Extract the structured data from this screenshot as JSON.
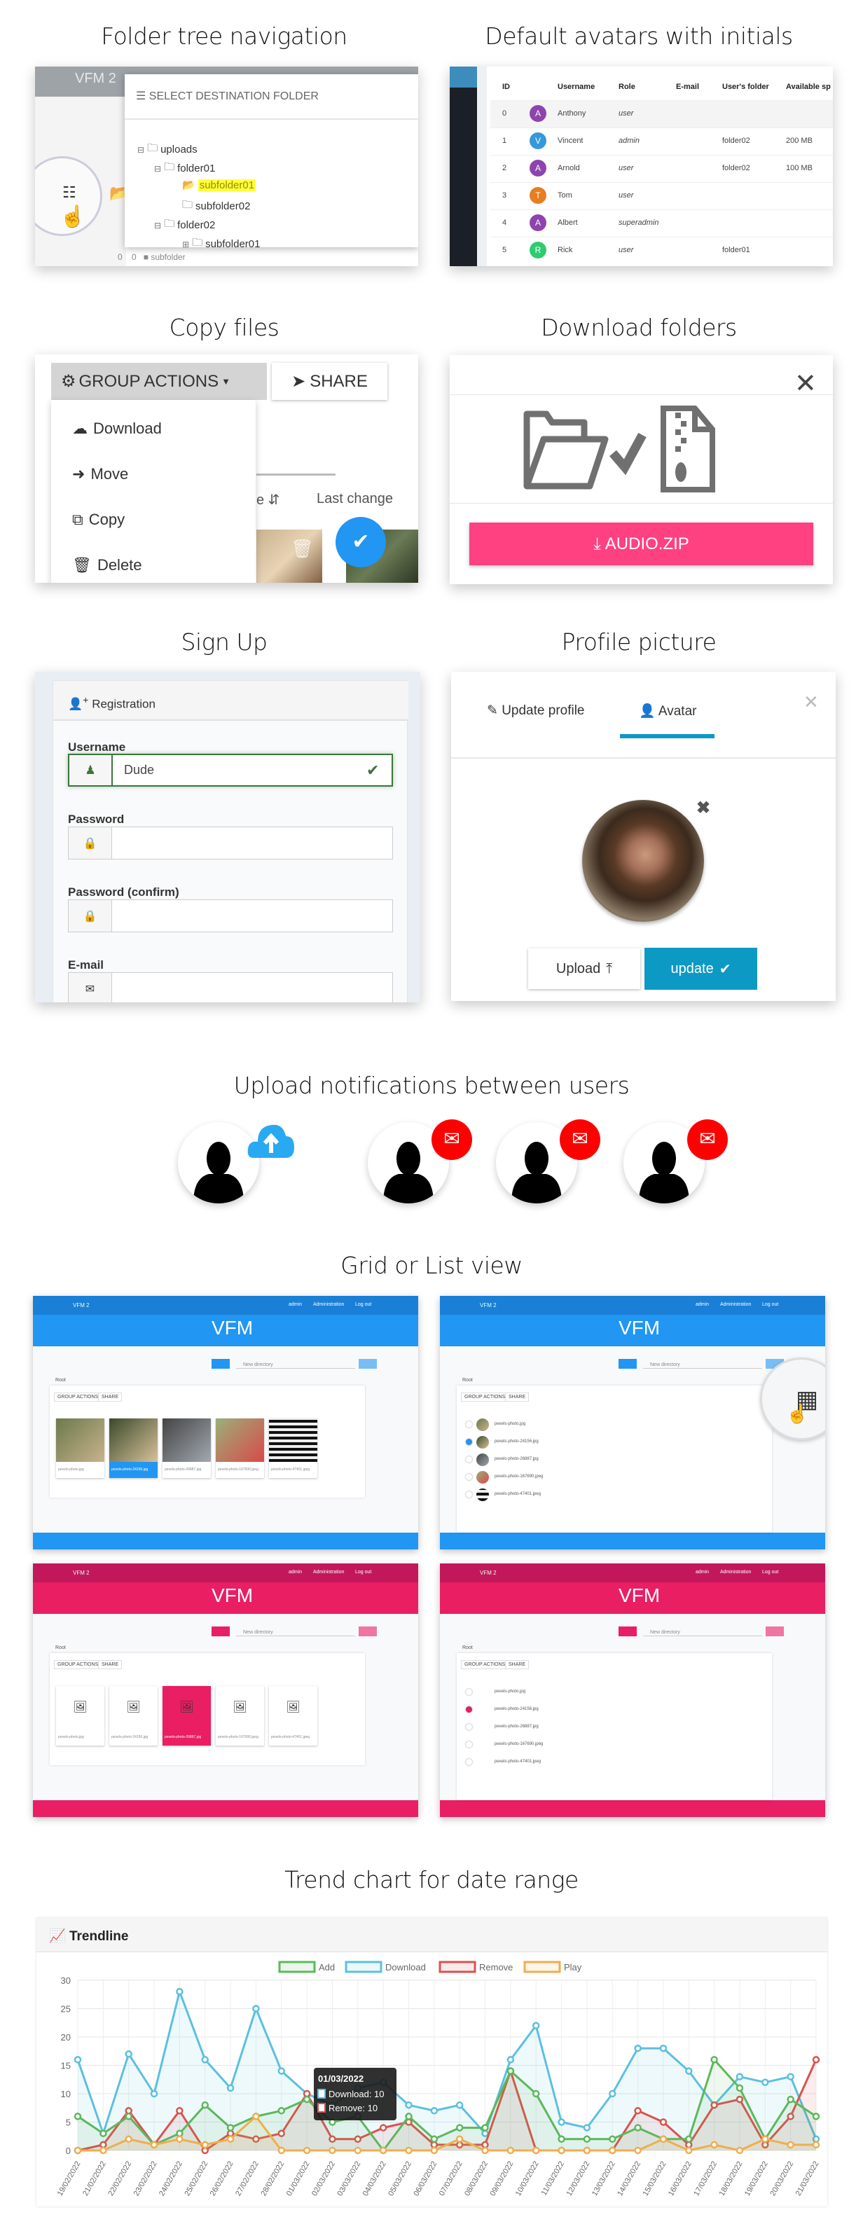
{
  "sections": {
    "folder_tree": "Folder tree navigation",
    "avatars": "Default avatars with initials",
    "copy": "Copy files",
    "download": "Download folders",
    "signup": "Sign Up",
    "profile": "Profile picture",
    "notifications": "Upload notifications between users",
    "gridlist": "Grid or List view",
    "trend": "Trend chart for date range"
  },
  "folder_tree": {
    "app_name": "VFM 2",
    "modal_title": "SELECT DESTINATION FOLDER",
    "tree": [
      {
        "label": "uploads",
        "level": 0,
        "toggle": "minus"
      },
      {
        "label": "folder01",
        "level": 1,
        "toggle": "minus"
      },
      {
        "label": "subfolder01",
        "level": 2,
        "selected": true
      },
      {
        "label": "subfolder02",
        "level": 2
      },
      {
        "label": "folder02",
        "level": 1,
        "toggle": "minus"
      },
      {
        "label": "subfolder01",
        "level": 2,
        "toggle": "plus"
      }
    ],
    "footer_counts": [
      "0",
      "0"
    ],
    "footer_folder": "subfolder"
  },
  "users_table": {
    "columns": [
      "ID",
      "Username",
      "Role",
      "E-mail",
      "User's folder",
      "Available sp"
    ],
    "rows": [
      {
        "id": "0",
        "initial": "A",
        "color": "#8e44ad",
        "username": "Anthony",
        "role": "user",
        "folder": "",
        "space": ""
      },
      {
        "id": "1",
        "initial": "V",
        "color": "#3498db",
        "username": "Vincent",
        "role": "admin",
        "folder": "folder02",
        "space": "200 MB"
      },
      {
        "id": "2",
        "initial": "A",
        "color": "#8e44ad",
        "username": "Arnold",
        "role": "user",
        "folder": "folder02",
        "space": "100 MB"
      },
      {
        "id": "3",
        "initial": "T",
        "color": "#e67e22",
        "username": "Tom",
        "role": "user",
        "folder": "",
        "space": ""
      },
      {
        "id": "4",
        "initial": "A",
        "color": "#8e44ad",
        "username": "Albert",
        "role": "superadmin",
        "folder": "",
        "space": ""
      },
      {
        "id": "5",
        "initial": "R",
        "color": "#2ecc71",
        "username": "Rick",
        "role": "user",
        "folder": "folder01",
        "space": ""
      }
    ]
  },
  "copy_files": {
    "group_actions": "GROUP ACTIONS",
    "share": "SHARE",
    "menu": [
      "Download",
      "Move",
      "Copy",
      "Delete"
    ],
    "col_size_fragment": "e",
    "col_last_change": "Last change"
  },
  "download": {
    "button": "AUDIO.ZIP",
    "button_color": "#ff4081"
  },
  "signup": {
    "title": "Registration",
    "username_label": "Username",
    "username_value": "Dude",
    "password_label": "Password",
    "confirm_label": "Password (confirm)",
    "email_label": "E-mail"
  },
  "profile": {
    "tab_update": "Update profile",
    "tab_avatar": "Avatar",
    "upload": "Upload",
    "update": "update",
    "accent": "#0c9ac4"
  },
  "mini_app": {
    "app_name": "VFM 2",
    "user": "admin",
    "admin_link": "Administration",
    "logout": "Log out",
    "logo": "VFM",
    "new_directory": "New directory",
    "root": "Root",
    "group_actions": "GROUP ACTIONS",
    "share": "SHARE",
    "files": [
      "pexels-photo.jpg",
      "pexels-photo-24156.jpg",
      "pexels-photo-26887.jpg",
      "pexels-photo-167690.jpeg",
      "pexels-photo-47401.jpeg"
    ],
    "themes": [
      {
        "color": "#2196f3",
        "dark": "#1a7fd6",
        "view": "grid"
      },
      {
        "color": "#2196f3",
        "dark": "#1a7fd6",
        "view": "list"
      },
      {
        "color": "#e91e63",
        "dark": "#c2185b",
        "view": "grid"
      },
      {
        "color": "#e91e63",
        "dark": "#c2185b",
        "view": "list"
      }
    ]
  },
  "chart_data": {
    "type": "line",
    "title": "Trendline",
    "ylim": [
      0,
      30
    ],
    "yticks": [
      0,
      5,
      10,
      15,
      20,
      25,
      30
    ],
    "grid": true,
    "legend": "top",
    "categories": [
      "19/02/2022",
      "21/02/2022",
      "22/02/2022",
      "23/02/2022",
      "24/02/2022",
      "25/02/2022",
      "26/02/2022",
      "27/02/2022",
      "28/02/2022",
      "01/03/2022",
      "02/03/2022",
      "03/03/2022",
      "04/03/2022",
      "05/03/2022",
      "06/03/2022",
      "07/03/2022",
      "08/03/2022",
      "09/03/2022",
      "10/03/2022",
      "11/03/2022",
      "12/03/2022",
      "13/03/2022",
      "14/03/2022",
      "15/03/2022",
      "16/03/2022",
      "17/03/2022",
      "18/03/2022",
      "19/03/2022",
      "20/03/2022",
      "21/03/2022"
    ],
    "series": [
      {
        "name": "Add",
        "color": "#5cb85c",
        "values": [
          6,
          3,
          6,
          1,
          3,
          8,
          4,
          6,
          7,
          9,
          5,
          6,
          0,
          6,
          2,
          4,
          4,
          14,
          10,
          2,
          2,
          2,
          4,
          2,
          2,
          16,
          11,
          2,
          9,
          6
        ]
      },
      {
        "name": "Download",
        "color": "#5bc0de",
        "values": [
          16,
          3,
          17,
          10,
          28,
          16,
          11,
          25,
          14,
          10,
          8,
          11,
          12,
          8,
          7,
          8,
          3,
          16,
          22,
          5,
          4,
          10,
          18,
          18,
          14,
          8,
          13,
          12,
          13,
          2
        ]
      },
      {
        "name": "Remove",
        "color": "#d9534f",
        "values": [
          0,
          1,
          7,
          1,
          7,
          0,
          3,
          2,
          3,
          10,
          2,
          2,
          4,
          5,
          1,
          1,
          1,
          14,
          0,
          0,
          0,
          0,
          7,
          5,
          1,
          8,
          9,
          1,
          6,
          16
        ]
      },
      {
        "name": "Play",
        "color": "#f0ad4e",
        "values": [
          0,
          0,
          2,
          1,
          2,
          1,
          2,
          6,
          0,
          0,
          0,
          0,
          0,
          0,
          0,
          2,
          0,
          0,
          0,
          0,
          0,
          0,
          0,
          2,
          0,
          1,
          0,
          2,
          1,
          1
        ]
      }
    ],
    "tooltip": {
      "title": "01/03/2022",
      "lines": [
        "Download: 10",
        "Remove: 10"
      ]
    }
  }
}
